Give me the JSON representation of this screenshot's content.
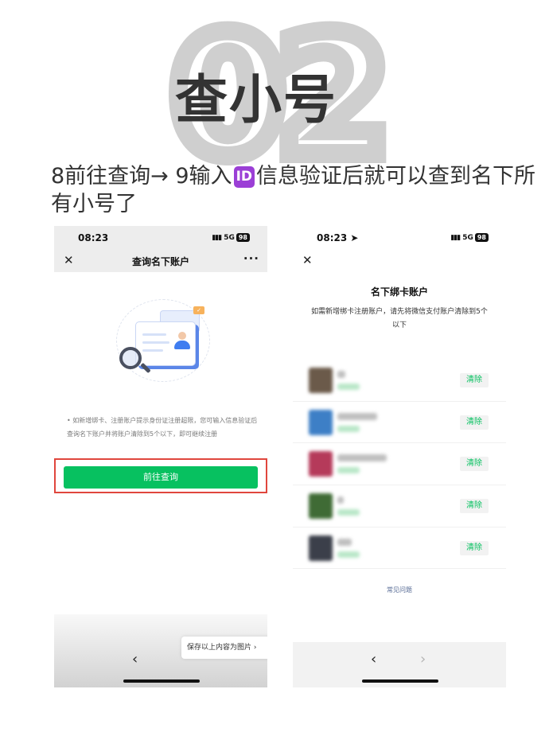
{
  "hero": {
    "number": "02",
    "title": "查小号"
  },
  "caption": {
    "part1": "8前往查询→ 9输入",
    "badge": "ID",
    "part2": "信息验证后就可以查到名下所有小号了"
  },
  "left_phone": {
    "time": "08:23",
    "network": "5G",
    "battery": "98",
    "nav_title": "查询名下账户",
    "notice": "• 如新增绑卡、注册账户提示身份证注册超限，您可输入信息验证后查询名下账户并将账户清除到5个以下，即可继续注册",
    "cta_label": "前往查询",
    "save_tip": "保存以上内容为图片 ›",
    "back_label": "‹"
  },
  "right_phone": {
    "time": "08:23",
    "network": "5G",
    "battery": "98",
    "title": "名下绑卡账户",
    "description": "如需新增绑卡注册账户，请先将微信支付账户清除到5个以下",
    "clear_label": "清除",
    "accounts": [
      {
        "thumb_color": "#6b5a4a",
        "name_width": 10
      },
      {
        "thumb_color": "#3d7fc6",
        "name_width": 50
      },
      {
        "thumb_color": "#b53a5a",
        "name_width": 62
      },
      {
        "thumb_color": "#3f6b35",
        "name_width": 8
      },
      {
        "thumb_color": "#3b3f4a",
        "name_width": 18
      }
    ],
    "faq": "常见问题",
    "back_label": "‹",
    "forward_label": "›"
  }
}
